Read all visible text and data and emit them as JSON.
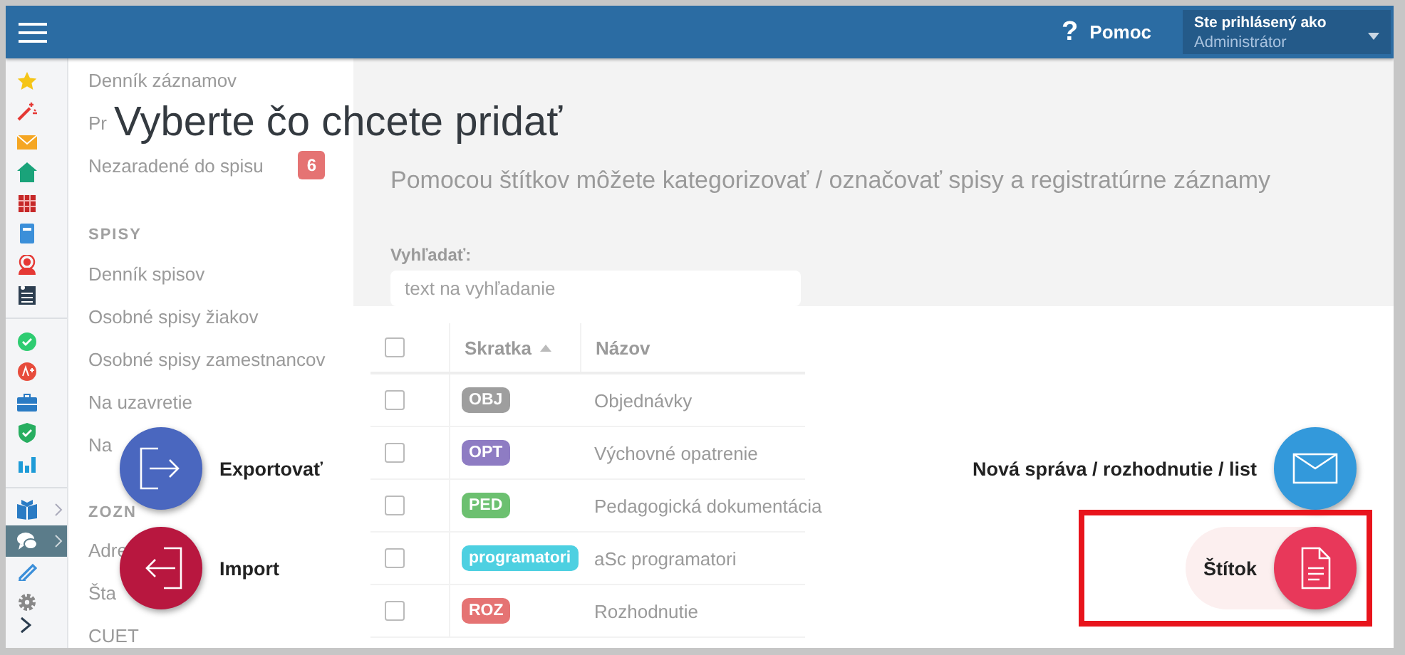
{
  "topbar": {
    "help": {
      "icon": "?",
      "label": "Pomoc"
    },
    "user": {
      "caption": "Ste prihlásený ako",
      "name": "Administrátor"
    }
  },
  "rail": {
    "groups": [
      [
        {
          "selected": false,
          "expandable": false
        },
        {
          "selected": false,
          "expandable": false
        },
        {
          "selected": false,
          "expandable": false
        },
        {
          "selected": false,
          "expandable": false
        },
        {
          "selected": false,
          "expandable": false
        },
        {
          "selected": false,
          "expandable": false
        },
        {
          "selected": false,
          "expandable": false
        },
        {
          "selected": false,
          "expandable": false
        }
      ],
      [
        {
          "selected": false,
          "expandable": false
        },
        {
          "selected": false,
          "expandable": false
        },
        {
          "selected": false,
          "expandable": false
        },
        {
          "selected": false,
          "expandable": false
        },
        {
          "selected": false,
          "expandable": false
        }
      ],
      [
        {
          "selected": false,
          "expandable": true
        },
        {
          "selected": true,
          "expandable": true
        },
        {
          "selected": false,
          "expandable": false
        },
        {
          "selected": false,
          "expandable": false
        }
      ]
    ]
  },
  "sidebar": {
    "items": [
      {
        "kind": "item",
        "label": "Denník záznamov"
      },
      {
        "kind": "item",
        "label": "Pr"
      },
      {
        "kind": "item",
        "label": "Nezaradené do spisu",
        "badge": "6"
      },
      {
        "kind": "section",
        "label": "SPISY"
      },
      {
        "kind": "item",
        "label": "Denník spisov"
      },
      {
        "kind": "item",
        "label": "Osobné spisy žiakov"
      },
      {
        "kind": "item",
        "label": "Osobné spisy zamestnancov"
      },
      {
        "kind": "item",
        "label": "Na uzavretie"
      },
      {
        "kind": "item",
        "label": "Na"
      },
      {
        "kind": "section",
        "label": "ZOZN"
      },
      {
        "kind": "item",
        "label": "Adre"
      },
      {
        "kind": "item",
        "label": "Šta"
      },
      {
        "kind": "item",
        "label": "CUET"
      }
    ]
  },
  "content": {
    "subtitle": "Pomocou štítkov môžete kategorizovať / označovať spisy a registratúrne záznamy",
    "search": {
      "label": "Vyhľadať:",
      "placeholder": "text na vyhľadanie"
    },
    "table": {
      "header_checked": false,
      "columns": [
        {
          "label": "Skratka",
          "sorted": true
        },
        {
          "label": "Názov",
          "sorted": false
        }
      ],
      "rows": [
        {
          "checked": false,
          "tag": "OBJ",
          "color": "#9e9e9e",
          "name": "Objednávky"
        },
        {
          "checked": false,
          "tag": "OPT",
          "color": "#8e7cc3",
          "name": "Výchovné opatrenie"
        },
        {
          "checked": false,
          "tag": "PED",
          "color": "#6cc070",
          "name": "Pedagogická dokumentácia"
        },
        {
          "checked": false,
          "tag": "programatori",
          "color": "#4dd0e1",
          "name": "aSc programatori"
        },
        {
          "checked": false,
          "tag": "ROZ",
          "color": "#e57373",
          "name": "Rozhodnutie"
        }
      ]
    }
  },
  "overlay": {
    "title": "Vyberte čo chcete pridať",
    "left_actions": [
      {
        "label": "Exportovať",
        "kind": "export",
        "color": "#4a67bf",
        "selected": false
      },
      {
        "label": "Import",
        "kind": "import",
        "color": "#b8173f",
        "selected": false
      }
    ],
    "right_actions": [
      {
        "label": "Nová správa / rozhodnutie / list",
        "kind": "message",
        "color": "#3399db",
        "selected": false
      },
      {
        "label": "Štítok",
        "kind": "label",
        "color": "#e8385a",
        "selected": true
      }
    ]
  }
}
